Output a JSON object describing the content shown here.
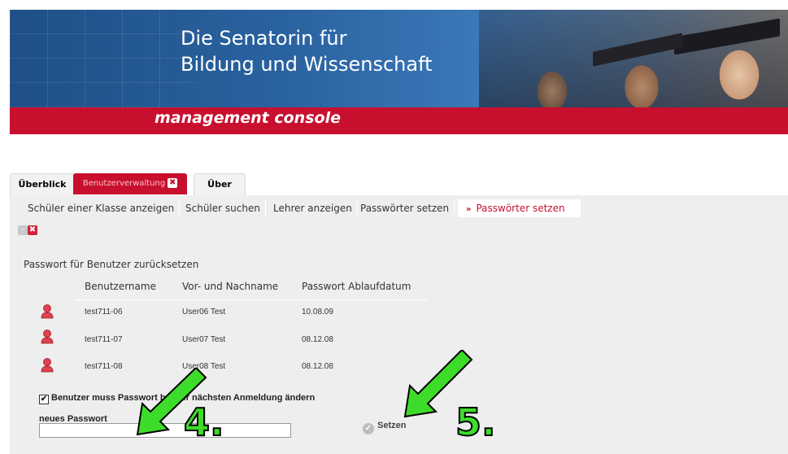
{
  "banner": {
    "title_line1": "Die Senatorin für",
    "title_line2": "Bildung und Wissenschaft",
    "subtitle": "management console"
  },
  "tabs": [
    {
      "label": "Überblick"
    },
    {
      "label": "Benutzerverwaltung",
      "close": "✖"
    },
    {
      "label": "Über"
    }
  ],
  "subnav": [
    {
      "label": "Schüler einer Klasse anzeigen"
    },
    {
      "label": "Schüler suchen"
    },
    {
      "label": "Lehrer anzeigen"
    },
    {
      "label": "Passwörter setzen"
    },
    {
      "label": "Passwörter setzen",
      "active": true,
      "arrow": "»"
    }
  ],
  "section_title": "Passwort für Benutzer zurücksetzen",
  "table": {
    "headers": [
      "Benutzername",
      "Vor- und Nachname",
      "Passwort Ablaufdatum"
    ],
    "rows": [
      {
        "username": "test711-06",
        "name": "User06 Test",
        "expiry": "10.08.09"
      },
      {
        "username": "test711-07",
        "name": "User07 Test",
        "expiry": "08.12.08"
      },
      {
        "username": "test711-08",
        "name": "User08 Test",
        "expiry": "08.12.08"
      }
    ]
  },
  "form": {
    "checkbox_label": "Benutzer muss Passwort bei der nächsten Anmeldung ändern",
    "checkbox_checked": true,
    "checkbox_mark": "✔",
    "password_label": "neues Passwort",
    "password_value": "",
    "submit_label": "Setzen",
    "submit_icon": "✓"
  },
  "annotations": [
    {
      "number": "4."
    },
    {
      "number": "5."
    }
  ],
  "colors": {
    "brand_red": "#c8102e",
    "banner_blue": "#2a62a0",
    "annotation_green": "#3ddc2a"
  },
  "icons": {
    "user": "user-icon",
    "close": "close-icon",
    "confirm": "check-circle-icon"
  }
}
